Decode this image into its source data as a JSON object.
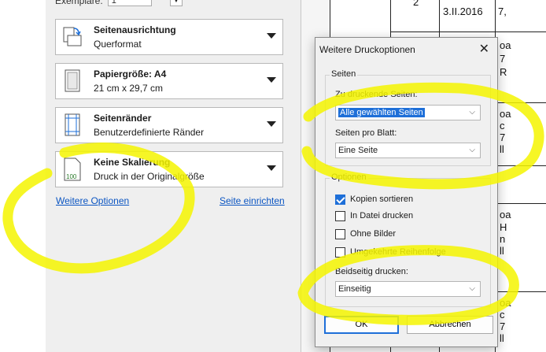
{
  "print_panel": {
    "copies_label": "Exemplare:",
    "copies_value": "1",
    "settings": [
      {
        "title": "Seitenausrichtung",
        "value": "Querformat",
        "icon": "page-orientation-icon"
      },
      {
        "title": "Papiergröße: A4",
        "value": "21 cm x 29,7 cm",
        "icon": "paper-size-icon"
      },
      {
        "title": "Seitenränder",
        "value": "Benutzerdefinierte Ränder",
        "icon": "margins-icon"
      },
      {
        "title": "Keine Skalierung",
        "value": "Druck in der Originalgröße",
        "icon": "scaling-icon",
        "icon_text": "100"
      }
    ],
    "more_options_link": "Weitere Optionen",
    "page_setup_link": "Seite einrichten"
  },
  "sheet_preview": {
    "cells": [
      "2",
      "3.II.2016",
      "7,",
      "oa",
      "7",
      "R",
      "oa",
      "c",
      "7",
      "ll",
      "oa",
      "H",
      "n",
      "ll",
      "oa",
      "c",
      "7",
      "ll"
    ]
  },
  "dialog": {
    "title": "Weitere Druckoptionen",
    "close_glyph": "✕",
    "pages_group": "Seiten",
    "pages_to_print_label": "Zu druckende Seiten:",
    "pages_to_print_value": "Alle gewählten Seiten",
    "pages_per_sheet_label": "Seiten pro Blatt:",
    "pages_per_sheet_value": "Eine Seite",
    "options_group": "Optionen",
    "checkboxes": [
      {
        "label": "Kopien sortieren",
        "checked": true
      },
      {
        "label": "In Datei drucken",
        "checked": false
      },
      {
        "label": "Ohne Bilder",
        "checked": false
      },
      {
        "label": "Umgekehrte Reihenfolge",
        "checked": false
      }
    ],
    "duplex_label": "Beidseitig drucken:",
    "duplex_value": "Einseitig",
    "ok_label": "OK",
    "cancel_label": "Abbrechen"
  },
  "colors": {
    "highlighter": "#f4f400",
    "accent": "#1e6fd8",
    "link": "#0b55c2"
  }
}
